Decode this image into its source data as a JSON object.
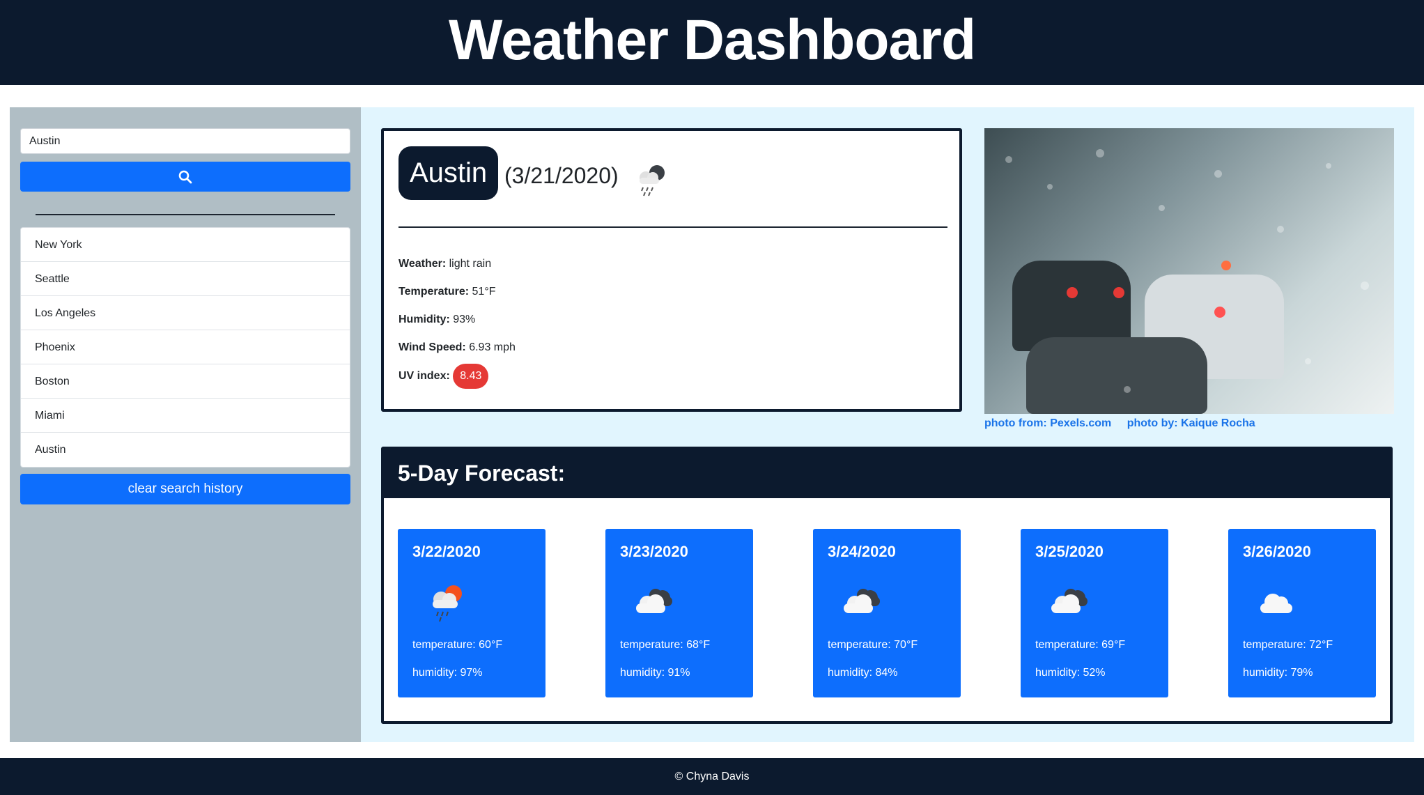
{
  "header": {
    "title": "Weather Dashboard"
  },
  "sidebar": {
    "search": {
      "value": "Austin",
      "button_icon": "search-icon"
    },
    "history": [
      "New York",
      "Seattle",
      "Los Angeles",
      "Phoenix",
      "Boston",
      "Miami",
      "Austin"
    ],
    "clear_label": "clear search history"
  },
  "current": {
    "city": "Austin",
    "date": "(3/21/2020)",
    "icon": "rain-cloud-night-icon",
    "weather_label": "Weather:",
    "weather_value": "light rain",
    "temperature_label": "Temperature:",
    "temperature_value": "51°F",
    "humidity_label": "Humidity:",
    "humidity_value": "93%",
    "wind_label": "Wind Speed:",
    "wind_value": "6.93 mph",
    "uv_label": "UV index:",
    "uv_value": "8.43",
    "uv_color": "#e53935"
  },
  "photo": {
    "credit_source": "photo from: Pexels.com",
    "credit_author": "photo by: Kaique Rocha"
  },
  "forecast": {
    "title": "5-Day Forecast:",
    "days": [
      {
        "date": "3/22/2020",
        "icon": "rain-cloud-sun-icon",
        "temperature": "temperature: 60°F",
        "humidity": "humidity: 97%"
      },
      {
        "date": "3/23/2020",
        "icon": "broken-clouds-icon",
        "temperature": "temperature: 68°F",
        "humidity": "humidity: 91%"
      },
      {
        "date": "3/24/2020",
        "icon": "broken-clouds-icon",
        "temperature": "temperature: 70°F",
        "humidity": "humidity: 84%"
      },
      {
        "date": "3/25/2020",
        "icon": "broken-clouds-icon",
        "temperature": "temperature: 69°F",
        "humidity": "humidity: 52%"
      },
      {
        "date": "3/26/2020",
        "icon": "cloud-icon",
        "temperature": "temperature: 72°F",
        "humidity": "humidity: 79%"
      }
    ]
  },
  "footer": {
    "text": "© Chyna Davis"
  },
  "colors": {
    "navy": "#0c1a2e",
    "primary": "#0d6efd",
    "sidebar": "#b0bec5",
    "main_bg": "#e1f5fe"
  }
}
